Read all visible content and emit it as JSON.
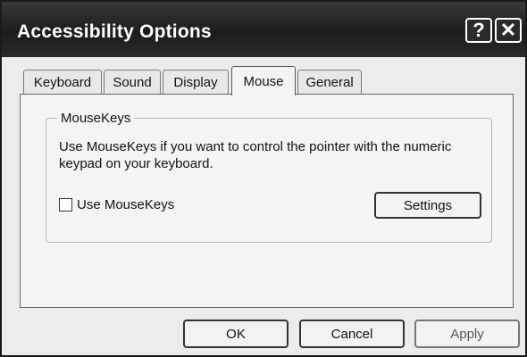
{
  "window": {
    "title": "Accessibility Options"
  },
  "titlebar": {
    "help_glyph": "?",
    "close_glyph": "✕"
  },
  "tabs": [
    {
      "label": "Keyboard"
    },
    {
      "label": "Sound"
    },
    {
      "label": "Display"
    },
    {
      "label": "Mouse",
      "active": true
    },
    {
      "label": "General"
    }
  ],
  "mousekeys": {
    "group_title": "MouseKeys",
    "description": "Use MouseKeys if you want to control the pointer with the numeric keypad on your keyboard.",
    "checkbox_label": "Use MouseKeys",
    "checkbox_checked": false,
    "settings_label": "Settings"
  },
  "buttons": {
    "ok": "OK",
    "cancel": "Cancel",
    "apply": "Apply"
  }
}
